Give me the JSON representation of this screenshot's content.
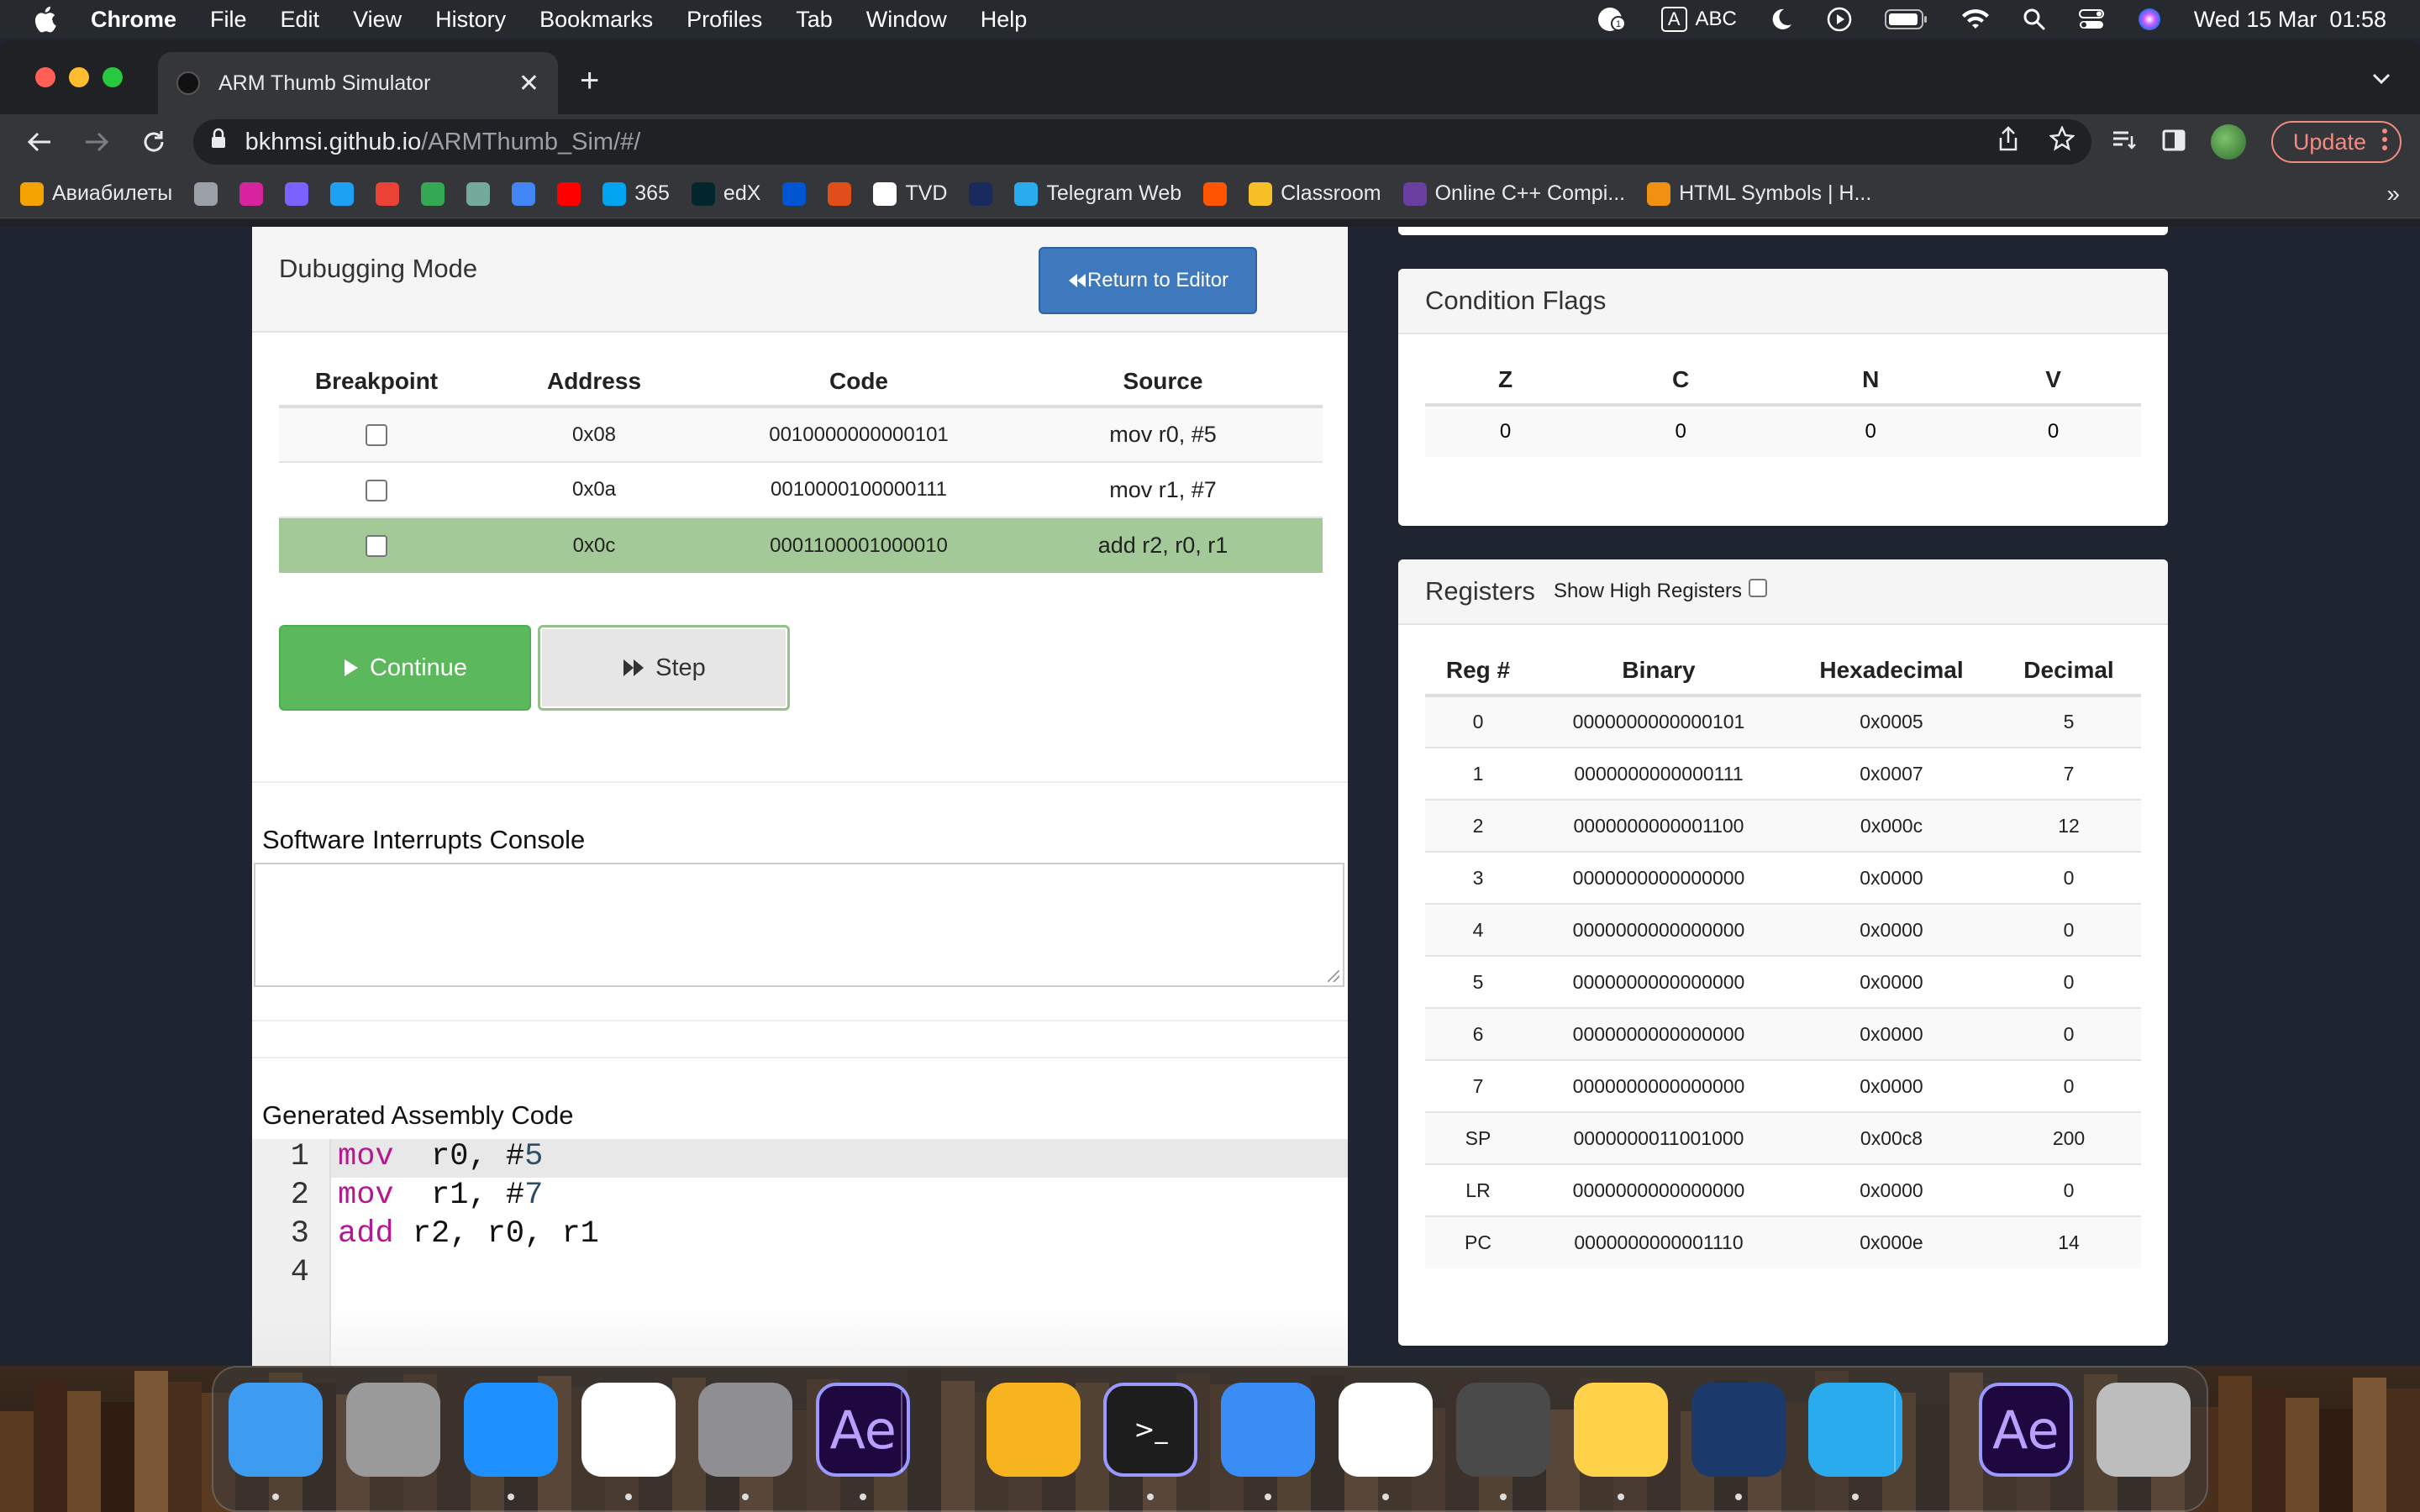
{
  "menubar": {
    "app": "Chrome",
    "items": [
      "File",
      "Edit",
      "View",
      "History",
      "Bookmarks",
      "Profiles",
      "Tab",
      "Window",
      "Help"
    ],
    "input_source": "ABC",
    "input_badge": "A",
    "datetime": "Wed 15 Mar  01:58"
  },
  "browser": {
    "tab_title": "ARM Thumb Simulator",
    "url_host": "bkhmsi.github.io",
    "url_path": "/ARMThumb_Sim/#/",
    "update_label": "Update",
    "bookmarks": [
      {
        "label": "Авиабилеты",
        "icon": "plane-icon",
        "color": "#f4a300"
      },
      {
        "label": "",
        "icon": "star-icon",
        "color": "#9aa0a6"
      },
      {
        "label": "",
        "icon": "instagram-icon",
        "color": "#d6249f"
      },
      {
        "label": "",
        "icon": "messenger-icon",
        "color": "#7b61ff"
      },
      {
        "label": "",
        "icon": "twitter-icon",
        "color": "#1da1f2"
      },
      {
        "label": "",
        "icon": "gmail-icon",
        "color": "#ea4335"
      },
      {
        "label": "",
        "icon": "drive-icon",
        "color": "#34a853"
      },
      {
        "label": "",
        "icon": "chatgpt-icon",
        "color": "#74aa9c"
      },
      {
        "label": "",
        "icon": "translate-icon",
        "color": "#4285f4"
      },
      {
        "label": "",
        "icon": "youtube-icon",
        "color": "#ff0000"
      },
      {
        "label": "365",
        "icon": "microsoft-icon",
        "color": "#00a4ef"
      },
      {
        "label": "edX",
        "icon": "edx-icon",
        "color": "#02262b"
      },
      {
        "label": "",
        "icon": "coursera-icon",
        "color": "#0056d2"
      },
      {
        "label": "",
        "icon": "cat-icon",
        "color": "#e04e1b"
      },
      {
        "label": "TVD",
        "icon": "film-icon",
        "color": "#ffffff"
      },
      {
        "label": "",
        "icon": "moon-icon",
        "color": "#1b2a5e"
      },
      {
        "label": "Telegram Web",
        "icon": "telegram-icon",
        "color": "#2aabee"
      },
      {
        "label": "",
        "icon": "soundcloud-icon",
        "color": "#ff5500"
      },
      {
        "label": "Classroom",
        "icon": "classroom-icon",
        "color": "#f6bf26"
      },
      {
        "label": "Online C++ Compi...",
        "icon": "bolt-icon",
        "color": "#6b3fa0"
      },
      {
        "label": "HTML Symbols | H...",
        "icon": "r-icon",
        "color": "#f29111"
      }
    ],
    "more": "»"
  },
  "debugger": {
    "title": "Dubugging Mode",
    "return_label": "Return to Editor",
    "columns": [
      "Breakpoint",
      "Address",
      "Code",
      "Source"
    ],
    "rows": [
      {
        "address": "0x08",
        "code": "0010000000000101",
        "source": "mov r0, #5"
      },
      {
        "address": "0x0a",
        "code": "0010000100000111",
        "source": "mov r1, #7"
      },
      {
        "address": "0x0c",
        "code": "0001100001000010",
        "source": "add r2, r0, r1"
      }
    ],
    "continue_label": "Continue",
    "step_label": "Step"
  },
  "console": {
    "title": "Software Interrupts Console",
    "value": ""
  },
  "assembly": {
    "title": "Generated Assembly Code",
    "lines": [
      {
        "num": "1",
        "op": "mov",
        "args": "  r0, #",
        "imm": "5"
      },
      {
        "num": "2",
        "op": "mov",
        "args": "  r1, #",
        "imm": "7"
      },
      {
        "num": "3",
        "op": "add",
        "args": " r2, r0, r1",
        "imm": ""
      },
      {
        "num": "4",
        "op": "",
        "args": "",
        "imm": ""
      }
    ]
  },
  "flags": {
    "title": "Condition Flags",
    "columns": [
      "Z",
      "C",
      "N",
      "V"
    ],
    "values": [
      "0",
      "0",
      "0",
      "0"
    ]
  },
  "registers": {
    "title": "Registers",
    "show_high_label": "Show High Registers",
    "columns": [
      "Reg #",
      "Binary",
      "Hexadecimal",
      "Decimal"
    ],
    "rows": [
      [
        "0",
        "0000000000000101",
        "0x0005",
        "5"
      ],
      [
        "1",
        "0000000000000111",
        "0x0007",
        "7"
      ],
      [
        "2",
        "0000000000001100",
        "0x000c",
        "12"
      ],
      [
        "3",
        "0000000000000000",
        "0x0000",
        "0"
      ],
      [
        "4",
        "0000000000000000",
        "0x0000",
        "0"
      ],
      [
        "5",
        "0000000000000000",
        "0x0000",
        "0"
      ],
      [
        "6",
        "0000000000000000",
        "0x0000",
        "0"
      ],
      [
        "7",
        "0000000000000000",
        "0x0000",
        "0"
      ],
      [
        "SP",
        "0000000011001000",
        "0x00c8",
        "200"
      ],
      [
        "LR",
        "0000000000000000",
        "0x0000",
        "0"
      ],
      [
        "PC",
        "0000000000001110",
        "0x000e",
        "14"
      ]
    ]
  },
  "dock": [
    {
      "name": "finder-icon",
      "color": "#3d9bf0",
      "running": true
    },
    {
      "name": "launchpad-icon",
      "color": "#9a9a9a",
      "running": false
    },
    {
      "name": "safari-icon",
      "color": "#1e90ff",
      "running": true
    },
    {
      "name": "chrome-icon",
      "color": "#ffffff",
      "running": true
    },
    {
      "name": "system-settings-icon",
      "color": "#8e8e93",
      "running": true
    },
    {
      "name": "after-effects-icon",
      "color": "#1f0740",
      "running": true,
      "text": "Ae"
    },
    {
      "name": "chrome-canary-icon",
      "color": "#f7b41e",
      "running": false
    },
    {
      "name": "terminal-icon",
      "color": "#1d1d1d",
      "running": true,
      "text": ">_"
    },
    {
      "name": "mail-icon",
      "color": "#3b8df6",
      "running": true
    },
    {
      "name": "vscode-icon",
      "color": "#ffffff",
      "running": true
    },
    {
      "name": "quicktime-icon",
      "color": "#4a4a4a",
      "running": true
    },
    {
      "name": "notes-icon",
      "color": "#ffd24a",
      "running": true
    },
    {
      "name": "steam-icon",
      "color": "#1b3a6b",
      "running": true
    },
    {
      "name": "telegram-icon",
      "color": "#2aabee",
      "running": true
    },
    {
      "name": "after-effects-doc-icon",
      "color": "#1f0740",
      "running": false,
      "text": "Ae"
    },
    {
      "name": "trash-icon",
      "color": "#bdbdbd",
      "running": false
    }
  ]
}
